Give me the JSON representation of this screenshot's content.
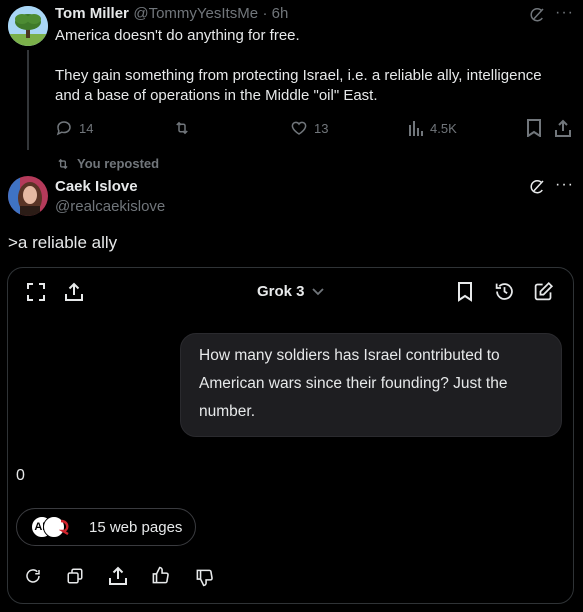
{
  "tweet1": {
    "author_name": "Tom Miller",
    "author_handle": "@TommyYesItsMe",
    "time": "· 6h",
    "line1": "America doesn't do anything for free.",
    "para2_line1": "They gain something from protecting Israel, i.e. a reliable ally, intelligence",
    "para2_line2": "and a base of operations in the Middle \"oil\" East.",
    "replies": "14",
    "likes": "13",
    "views": "4.5K"
  },
  "repost_label": "You reposted",
  "tweet2": {
    "author_name": "Caek Islove",
    "author_handle": "@realcaekislove",
    "text": ">a reliable ally"
  },
  "grok": {
    "model_label": "Grok 3",
    "question_line1": "How many soldiers has Israel contributed to",
    "question_line2": "American wars since their founding? Just the",
    "question_line3": "number.",
    "answer": "0",
    "sources_label": "15 web pages",
    "source_logo_text": "AP"
  },
  "colors": {
    "background": "#000000",
    "text": "#e7e9ea",
    "muted": "#71767b",
    "border": "#2f3336",
    "bubble": "#1e1e21"
  }
}
